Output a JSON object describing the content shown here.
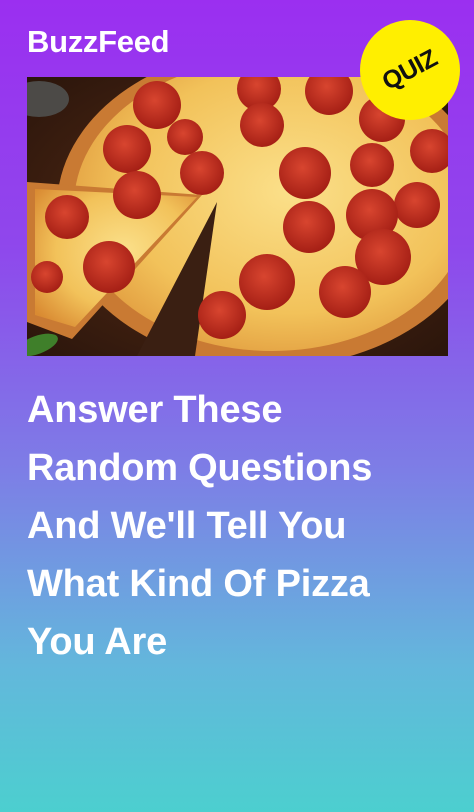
{
  "brand": {
    "name": "BuzzFeed"
  },
  "badge": {
    "label": "QUIZ",
    "color": "#ffef00"
  },
  "hero_image": {
    "icon": "pepperoni-pizza-photo"
  },
  "headline": {
    "lines": [
      "Answer These",
      "Random Questions",
      "And We'll Tell You",
      "What Kind Of Pizza",
      "You Are"
    ]
  },
  "colors": {
    "gradient_top": "#9b2ff0",
    "gradient_bottom": "#4ccfcf",
    "text": "#ffffff"
  }
}
